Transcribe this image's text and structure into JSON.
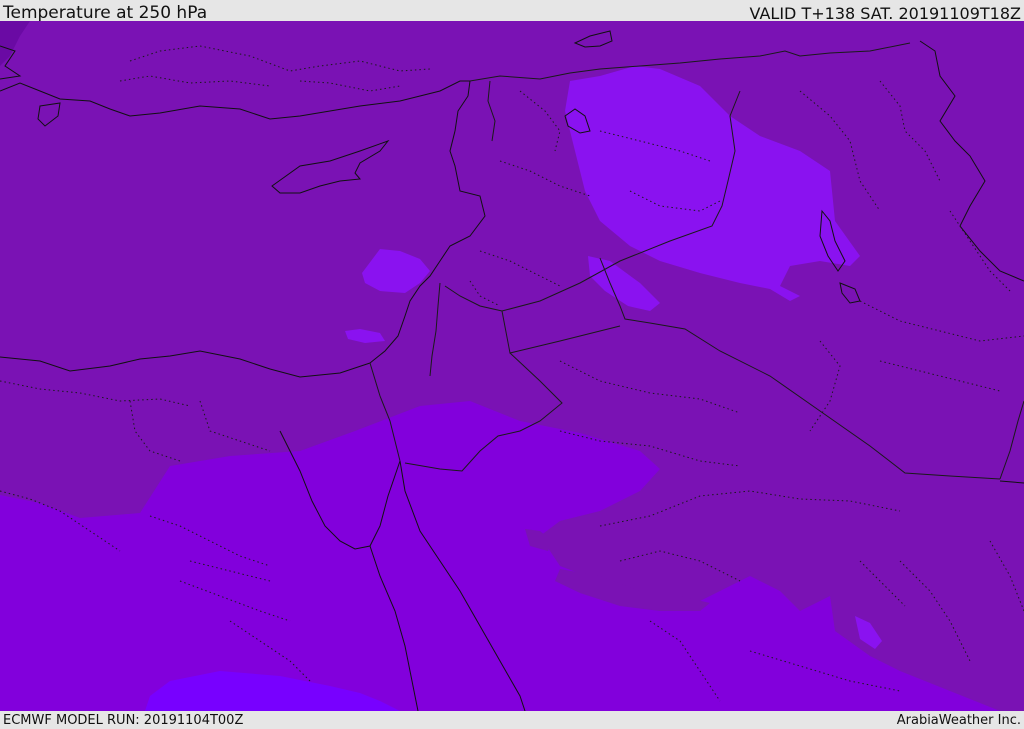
{
  "header": {
    "title": "Temperature at 250 hPa",
    "valid": "VALID T+138 SAT. 20191109T18Z"
  },
  "footer": {
    "model_run": "ECMWF MODEL RUN: 20191104T00Z",
    "credit": "ArabiaWeather Inc."
  },
  "map": {
    "field": "temperature",
    "level": "250 hPa",
    "colors": {
      "base": "#7a12b4",
      "dark": "#6a0aa4",
      "mid": "#8200dc",
      "light": "#8a12f0",
      "lightest": "#7800ff",
      "coast": "#111111",
      "border": "#1a1a1a"
    }
  }
}
